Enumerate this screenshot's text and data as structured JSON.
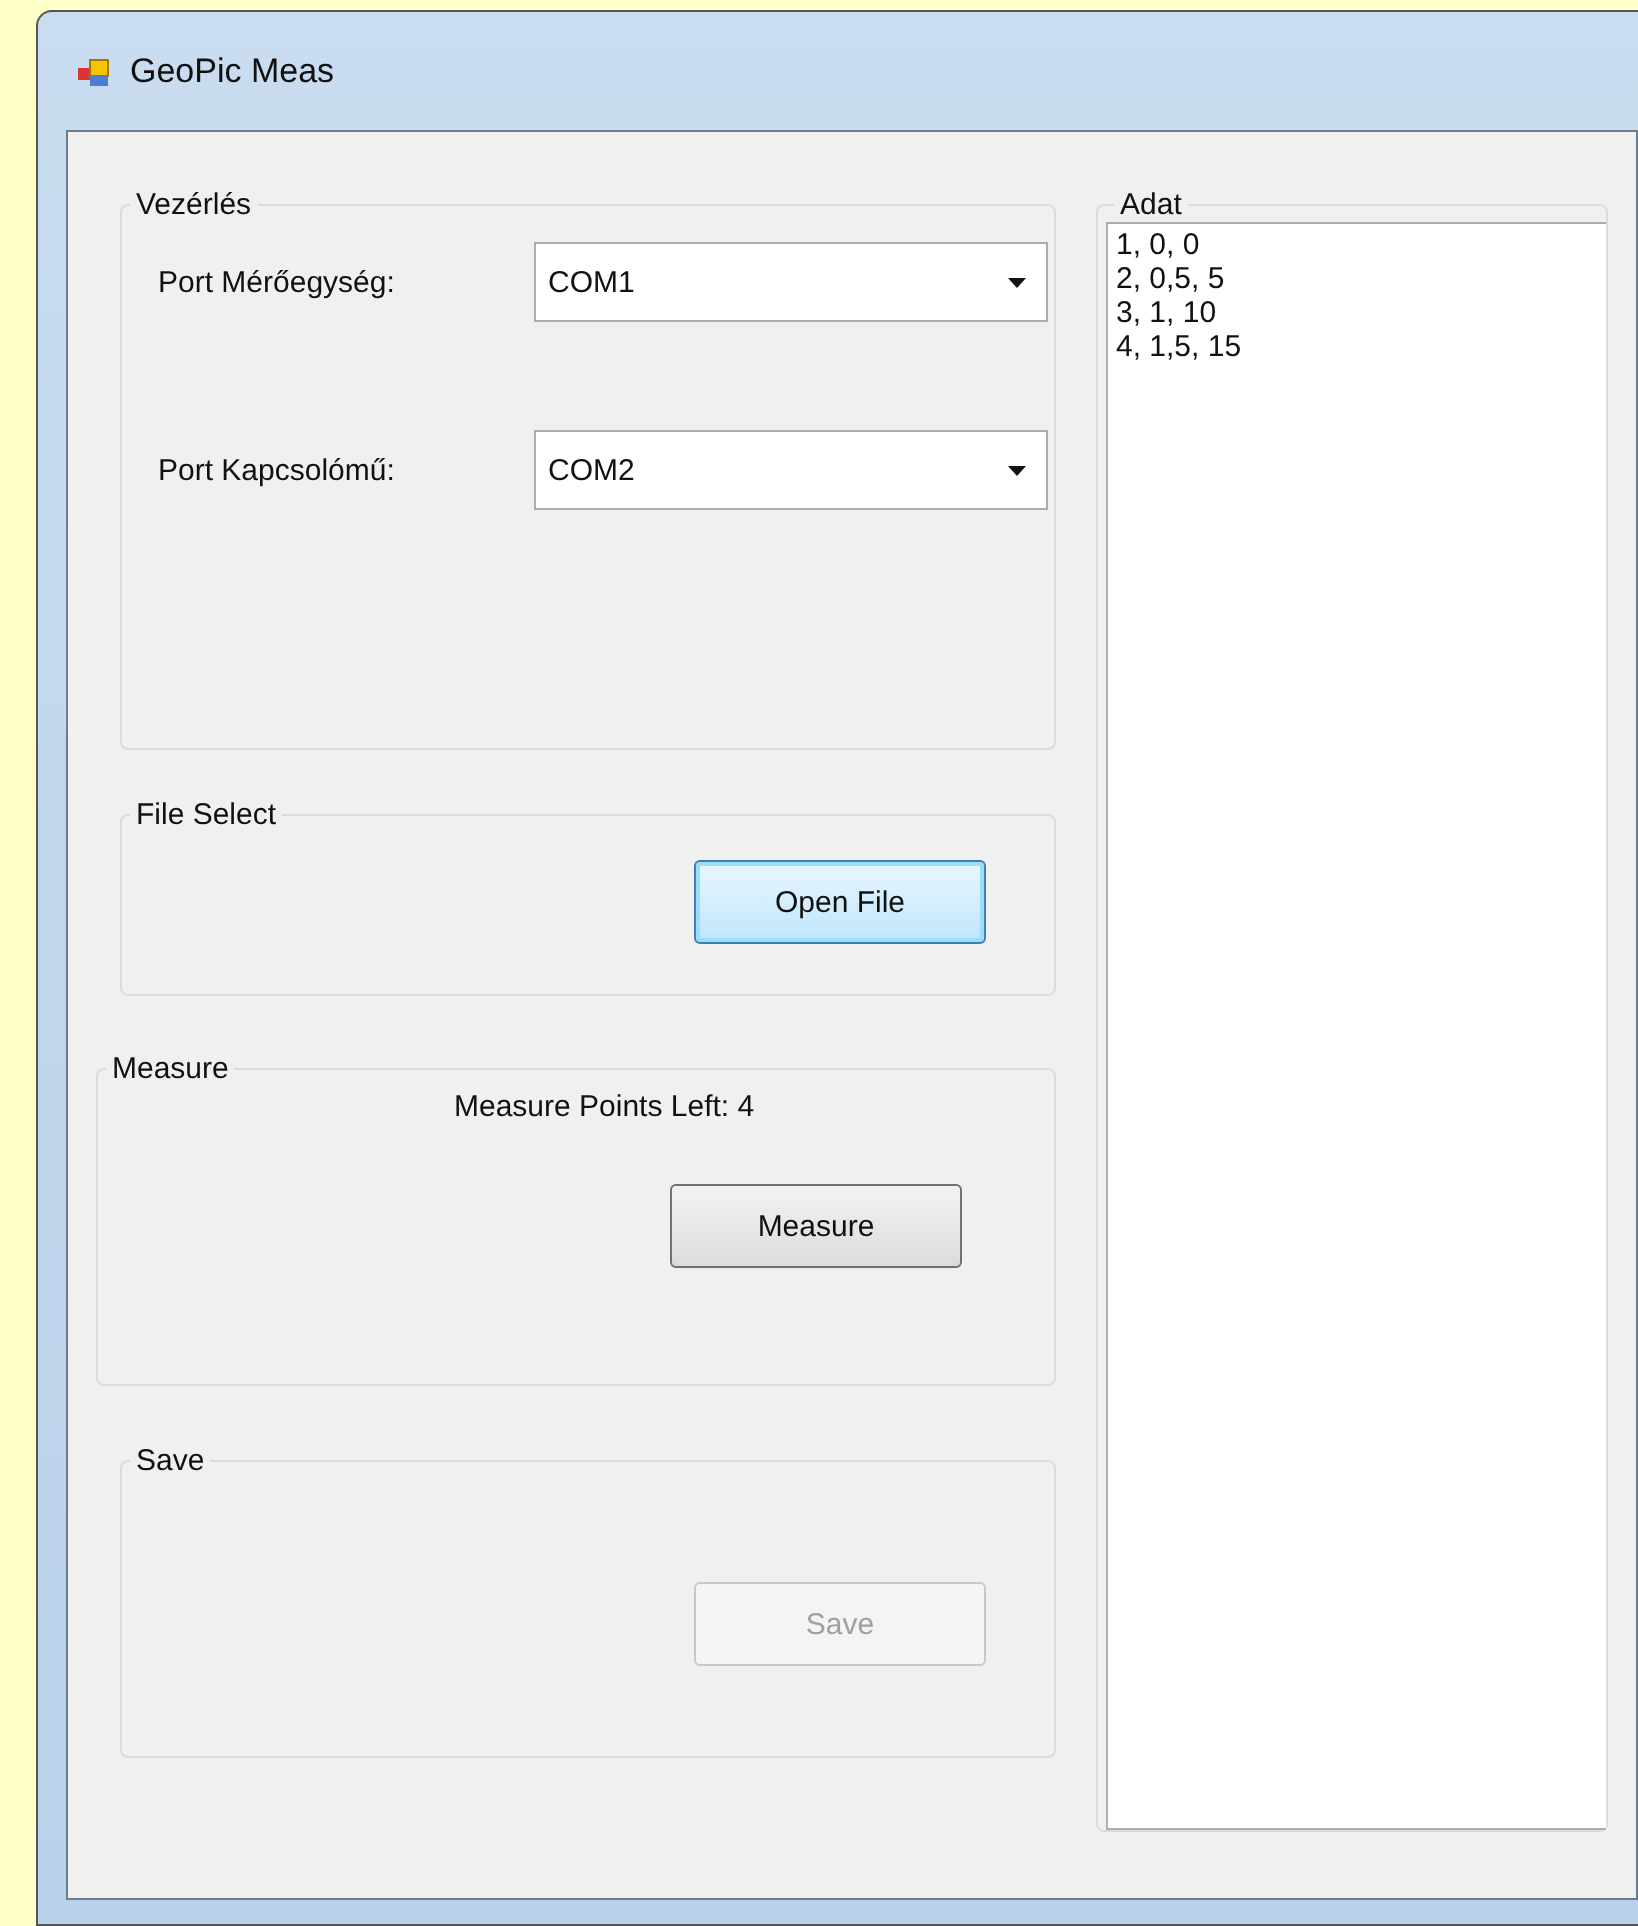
{
  "window": {
    "title": "GeoPic Meas"
  },
  "control_group": {
    "title": "Vezérlés",
    "ports": [
      {
        "label": "Port Mérőegység:",
        "value": "COM1"
      },
      {
        "label": "Port Kapcsolómű:",
        "value": "COM2"
      }
    ]
  },
  "file_group": {
    "title": "File Select",
    "button": {
      "label": "Open File",
      "focused": true,
      "disabled": false
    }
  },
  "measure_group": {
    "title": "Measure",
    "status": "Measure Points Left: 4",
    "button": {
      "label": "Measure",
      "focused": false,
      "disabled": false
    }
  },
  "save_group": {
    "title": "Save",
    "button": {
      "label": "Save",
      "focused": false,
      "disabled": true
    }
  },
  "data_group": {
    "title": "Adat",
    "lines": [
      "1, 0, 0",
      "2, 0,5, 5",
      "3, 1, 10",
      "4, 1,5, 15"
    ]
  }
}
